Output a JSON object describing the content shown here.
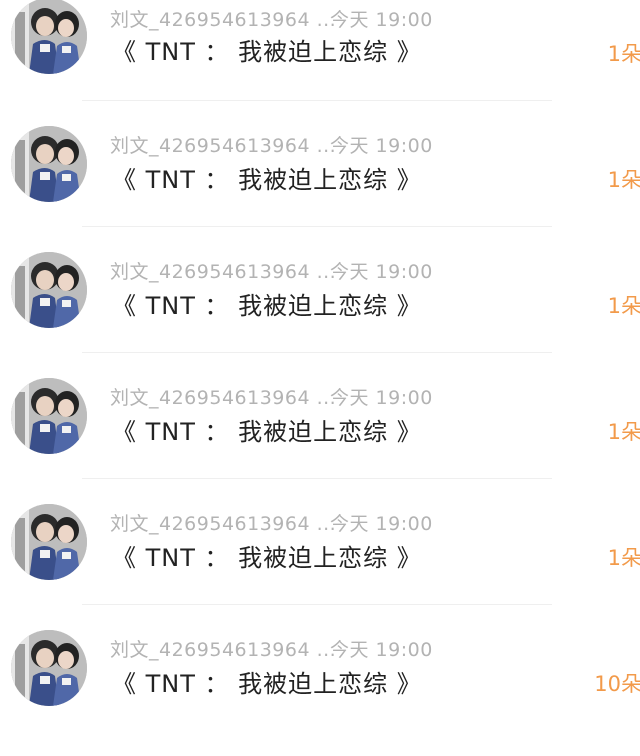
{
  "colors": {
    "meta_text": "#b3b3b3",
    "message_text": "#222222",
    "count_accent": "#f29a4a",
    "divider": "#efefef"
  },
  "rows": [
    {
      "sender": "刘文_426954613964 ...",
      "time": "今天 19:00",
      "message": "《 TNT ： 我被迫上恋综 》",
      "count": "1朵"
    },
    {
      "sender": "刘文_426954613964 ...",
      "time": "今天 19:00",
      "message": "《 TNT ： 我被迫上恋综 》",
      "count": "1朵"
    },
    {
      "sender": "刘文_426954613964 ...",
      "time": "今天 19:00",
      "message": "《 TNT ： 我被迫上恋综 》",
      "count": "1朵"
    },
    {
      "sender": "刘文_426954613964 ...",
      "time": "今天 19:00",
      "message": "《 TNT ： 我被迫上恋综 》",
      "count": "1朵"
    },
    {
      "sender": "刘文_426954613964 ...",
      "time": "今天 19:00",
      "message": "《 TNT ： 我被迫上恋综 》",
      "count": "1朵"
    },
    {
      "sender": "刘文_426954613964 ...",
      "time": "今天 19:00",
      "message": "《 TNT ： 我被迫上恋综 》",
      "count": "10朵"
    }
  ]
}
